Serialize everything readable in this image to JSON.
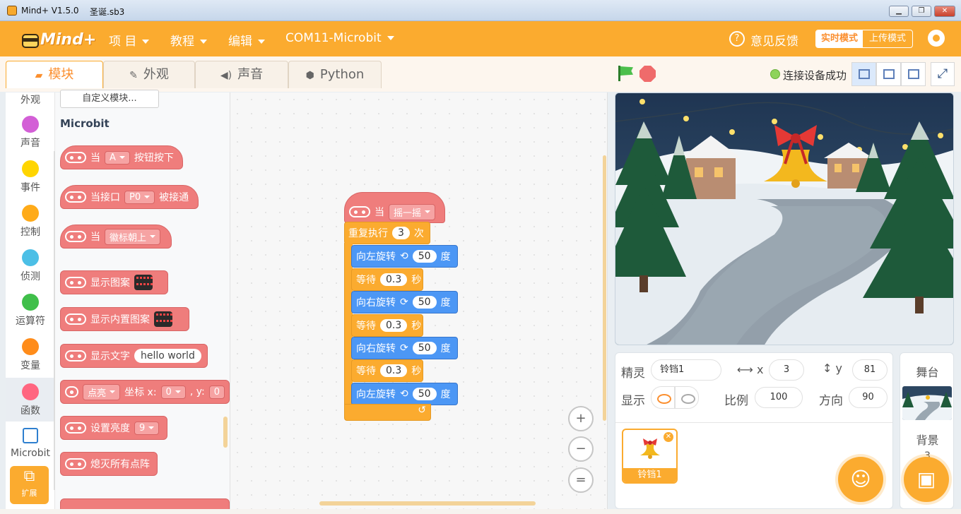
{
  "window": {
    "title": "Mind+ V1.5.0",
    "file": "圣诞.sb3",
    "buttons": [
      "minimize",
      "restore",
      "close"
    ]
  },
  "menu": {
    "logo": "Mind+",
    "items": [
      {
        "label": "项 目"
      },
      {
        "label": "教程"
      },
      {
        "label": "编辑"
      },
      {
        "label": "COM11-Microbit"
      }
    ],
    "feedback": "意见反馈",
    "realtime_mode": "实时模式",
    "upload_mode": "上传模式"
  },
  "tabs": [
    {
      "label": "模块",
      "icon": "blocks-icon",
      "active": true
    },
    {
      "label": "外观",
      "icon": "brush-icon",
      "active": false
    },
    {
      "label": "声音",
      "icon": "speaker-icon",
      "active": false
    },
    {
      "label": "Python",
      "icon": "python-icon",
      "active": false
    }
  ],
  "device_status": "连接设备成功",
  "categories": [
    {
      "label": "外观",
      "color": "#9966ff"
    },
    {
      "label": "声音",
      "color": "#cf63cf"
    },
    {
      "label": "事件",
      "color": "#ffd500"
    },
    {
      "label": "控制",
      "color": "#ffab19"
    },
    {
      "label": "侦测",
      "color": "#5cb1d6"
    },
    {
      "label": "运算符",
      "color": "#59c059"
    },
    {
      "label": "变量",
      "color": "#ff8c1a"
    },
    {
      "label": "函数",
      "color": "#ff6680"
    },
    {
      "label": "Microbit",
      "color": "#2e7fcf"
    }
  ],
  "extension_label": "扩展",
  "palette": {
    "custom_block_button": "自定义模块...",
    "section_title": "Microbit",
    "blocks": {
      "when_button": {
        "prefix": "当",
        "dropdown": "A",
        "suffix": "按钮按下"
      },
      "when_pin": {
        "prefix": "当接口",
        "dropdown": "P0",
        "suffix": "被接通"
      },
      "when_gesture": {
        "prefix": "当",
        "dropdown": "徽标朝上"
      },
      "show_pattern": {
        "label": "显示图案"
      },
      "show_builtin": {
        "label": "显示内置图案"
      },
      "show_text": {
        "label": "显示文字",
        "value": "hello world"
      },
      "plot": {
        "dropdown": "点亮",
        "x_label": "坐标 x:",
        "x_value": "0",
        "y_label": ", y:",
        "y_value": "0"
      },
      "brightness": {
        "label": "设置亮度",
        "dropdown": "9"
      },
      "clear": {
        "label": "熄灭所有点阵"
      }
    }
  },
  "script": {
    "hat": {
      "prefix": "当",
      "dropdown": "摇一摇"
    },
    "repeat": {
      "prefix": "重复执行",
      "times": "3",
      "suffix": "次"
    },
    "steps": [
      {
        "kind": "turn",
        "label": "向左旋转",
        "dir": "left",
        "value": "50",
        "unit": "度"
      },
      {
        "kind": "wait",
        "label": "等待",
        "value": "0.3",
        "unit": "秒"
      },
      {
        "kind": "turn",
        "label": "向右旋转",
        "dir": "right",
        "value": "50",
        "unit": "度"
      },
      {
        "kind": "wait",
        "label": "等待",
        "value": "0.3",
        "unit": "秒"
      },
      {
        "kind": "turn",
        "label": "向右旋转",
        "dir": "right",
        "value": "50",
        "unit": "度"
      },
      {
        "kind": "wait",
        "label": "等待",
        "value": "0.3",
        "unit": "秒"
      },
      {
        "kind": "turn",
        "label": "向左旋转",
        "dir": "left",
        "value": "50",
        "unit": "度"
      }
    ],
    "repeat_end_icon": "↺"
  },
  "zoom": {
    "in": "+",
    "out": "−",
    "reset": "="
  },
  "sprite": {
    "sprite_label": "精灵",
    "name": "铃铛1",
    "x_label": "x",
    "x": "3",
    "y_label": "y",
    "y": "81",
    "show_label": "显示",
    "size_label": "比例",
    "size": "100",
    "direction_label": "方向",
    "direction": "90",
    "thumbnail_name": "铃铛1"
  },
  "stage_panel": {
    "title": "舞台",
    "backdrop_label": "背景",
    "backdrop_count": "3"
  },
  "colors": {
    "accent": "#fbab2f",
    "event": "#ef7d7c",
    "motion": "#4c97f5",
    "control": "#fbab2f"
  }
}
